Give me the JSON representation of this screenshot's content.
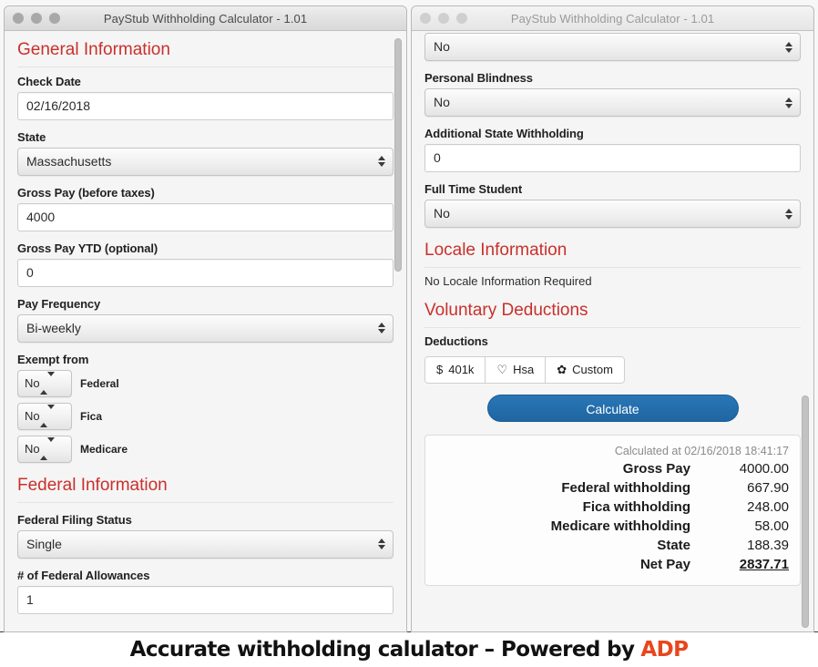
{
  "window_left": {
    "title": "PayStub Withholding Calculator - 1.01",
    "traffic_lights": [
      "close-dot",
      "minimize-dot",
      "zoom-dot"
    ],
    "sections": {
      "general": {
        "heading": "General Information",
        "check_date": {
          "label": "Check Date",
          "value": "02/16/2018"
        },
        "state": {
          "label": "State",
          "value": "Massachusetts"
        },
        "gross_pay": {
          "label": "Gross Pay (before taxes)",
          "value": "4000"
        },
        "gross_pay_ytd": {
          "label": "Gross Pay YTD (optional)",
          "value": "0"
        },
        "pay_frequency": {
          "label": "Pay Frequency",
          "value": "Bi-weekly"
        },
        "exempt_from": {
          "label": "Exempt from",
          "rows": [
            {
              "value": "No",
              "label": "Federal"
            },
            {
              "value": "No",
              "label": "Fica"
            },
            {
              "value": "No",
              "label": "Medicare"
            }
          ]
        }
      },
      "federal": {
        "heading": "Federal Information",
        "filing_status": {
          "label": "Federal Filing Status",
          "value": "Single"
        },
        "allowances": {
          "label": "# of Federal Allowances",
          "value": "1"
        }
      }
    }
  },
  "window_right": {
    "title": "PayStub Withholding Calculator - 1.01",
    "top_cut_select": {
      "value": "No"
    },
    "personal_blindness": {
      "label": "Personal Blindness",
      "value": "No"
    },
    "additional_state_withholding": {
      "label": "Additional State Withholding",
      "value": "0"
    },
    "full_time_student": {
      "label": "Full Time Student",
      "value": "No"
    },
    "locale": {
      "heading": "Locale Information",
      "note": "No Locale Information Required"
    },
    "voluntary": {
      "heading": "Voluntary Deductions",
      "deductions_label": "Deductions",
      "buttons": [
        {
          "icon": "dollar-icon",
          "glyph": "$",
          "label": "401k"
        },
        {
          "icon": "heart-icon",
          "glyph": "♡",
          "label": "Hsa"
        },
        {
          "icon": "gear-icon",
          "glyph": "✿",
          "label": "Custom"
        }
      ],
      "calculate_label": "Calculate"
    },
    "results": {
      "calculated_at": "Calculated at 02/16/2018 18:41:17",
      "rows": [
        {
          "label": "Gross Pay",
          "value": "4000.00",
          "total": false
        },
        {
          "label": "Federal withholding",
          "value": "667.90",
          "total": false
        },
        {
          "label": "Fica withholding",
          "value": "248.00",
          "total": false
        },
        {
          "label": "Medicare withholding",
          "value": "58.00",
          "total": false
        },
        {
          "label": "State",
          "value": "188.39",
          "total": false
        },
        {
          "label": "Net Pay",
          "value": "2837.71",
          "total": true
        }
      ]
    }
  },
  "caption": {
    "text": "Accurate withholding calulator – Powered by",
    "brand": "ADP"
  },
  "colors": {
    "section_heading": "#c9302c",
    "calculate_button": "#1f66a3",
    "brand": "#e8461e",
    "window_bg": "#f5f5f5"
  }
}
